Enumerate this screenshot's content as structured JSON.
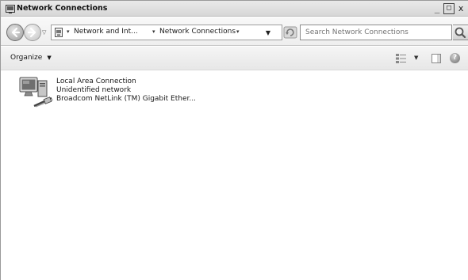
{
  "window": {
    "title": "Network Connections",
    "controls": {
      "minimize": "_",
      "maximize": "□",
      "close": "x"
    }
  },
  "address_bar": {
    "breadcrumb": [
      "Network and Int...",
      "Network Connections"
    ],
    "search_placeholder": "Search Network Connections"
  },
  "command_bar": {
    "organize_label": "Organize",
    "help_symbol": "?"
  },
  "items": [
    {
      "name": "Local Area Connection",
      "status": "Unidentified network",
      "device": "Broadcom NetLink (TM) Gigabit Ether..."
    }
  ],
  "icons": {
    "window_icon": "network-folder-icon",
    "back": "back-arrow-icon",
    "forward": "forward-arrow-icon",
    "refresh": "refresh-icon",
    "search": "search-icon",
    "views": "views-icon",
    "preview": "preview-pane-icon",
    "help": "help-icon",
    "connection": "network-adapter-icon"
  }
}
